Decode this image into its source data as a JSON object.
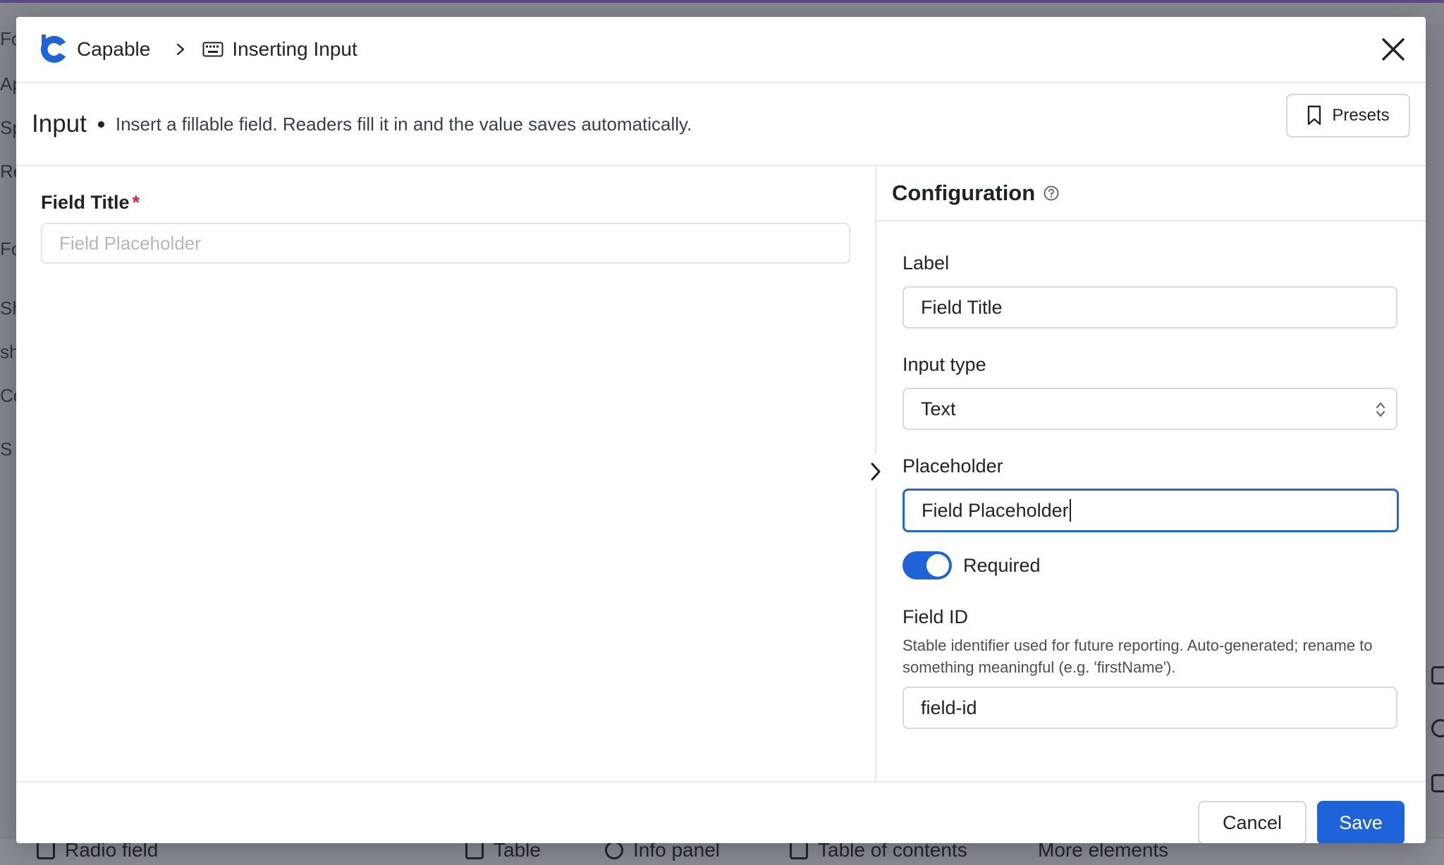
{
  "modal": {
    "brand": {
      "name": "Capable"
    },
    "breadcrumb": {
      "current": "Inserting Input"
    },
    "header": {
      "title": "Input",
      "description": "Insert a fillable field. Readers fill it in and the value saves automatically.",
      "presets_label": "Presets"
    },
    "preview": {
      "field_title": "Field Title",
      "required_mark": "*",
      "placeholder": "Field Placeholder"
    },
    "configuration": {
      "title": "Configuration",
      "label": {
        "label": "Label",
        "value": "Field Title"
      },
      "input_type": {
        "label": "Input type",
        "value": "Text"
      },
      "placeholder": {
        "label": "Placeholder",
        "value": "Field Placeholder"
      },
      "required": {
        "label": "Required",
        "enabled": true
      },
      "field_id": {
        "label": "Field ID",
        "help": "Stable identifier used for future reporting. Auto-generated; rename to something meaningful (e.g. 'firstName').",
        "value": "field-id"
      }
    },
    "footer": {
      "cancel_label": "Cancel",
      "save_label": "Save"
    }
  },
  "background": {
    "sidebar_fragments": [
      "Fo",
      "Ap",
      "Sp",
      "Re",
      "Fo",
      "Sh",
      "sh",
      "Co",
      "S"
    ],
    "bottom_toolbar": [
      "Radio field",
      "Table",
      "Info panel",
      "Table of contents",
      "More elements"
    ]
  },
  "colors": {
    "accent": "#1f63d8",
    "required": "#d1242f",
    "overlay": "#85878f"
  }
}
